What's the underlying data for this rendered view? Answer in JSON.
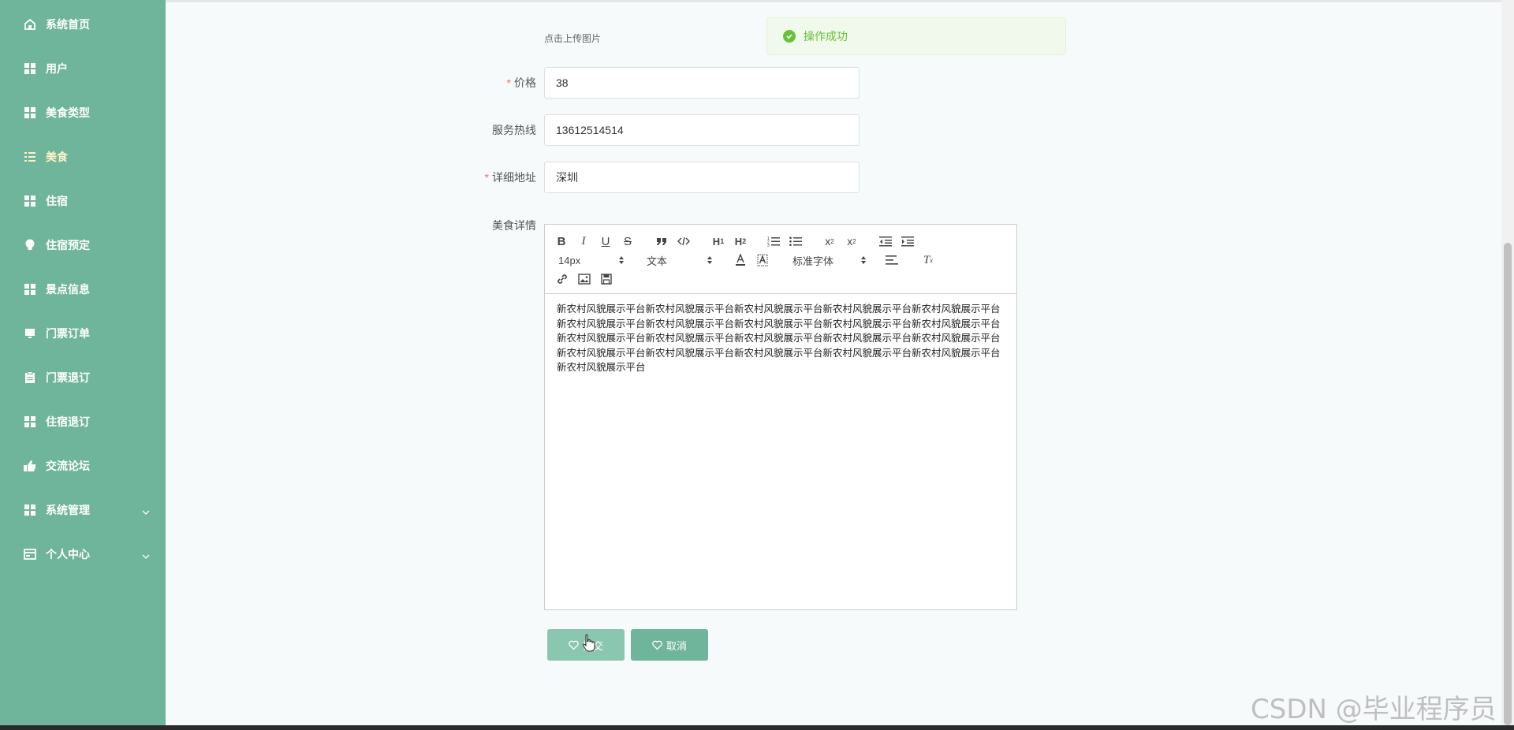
{
  "sidebar": {
    "items": [
      {
        "label": "系统首页",
        "icon": "home-icon"
      },
      {
        "label": "用户",
        "icon": "grid-icon"
      },
      {
        "label": "美食类型",
        "icon": "grid-icon"
      },
      {
        "label": "美食",
        "icon": "list-icon",
        "active": true
      },
      {
        "label": "住宿",
        "icon": "grid-icon"
      },
      {
        "label": "住宿预定",
        "icon": "bulb-icon"
      },
      {
        "label": "景点信息",
        "icon": "grid-icon"
      },
      {
        "label": "门票订单",
        "icon": "monitor-icon"
      },
      {
        "label": "门票退订",
        "icon": "clipboard-icon"
      },
      {
        "label": "住宿退订",
        "icon": "grid-icon"
      },
      {
        "label": "交流论坛",
        "icon": "thumb-icon"
      },
      {
        "label": "系统管理",
        "icon": "grid-icon",
        "expandable": true
      },
      {
        "label": "个人中心",
        "icon": "card-icon",
        "expandable": true
      }
    ]
  },
  "form": {
    "upload_hint": "点击上传图片",
    "price_label": "价格",
    "price_value": "38",
    "hotline_label": "服务热线",
    "hotline_value": "13612514514",
    "address_label": "详细地址",
    "address_value": "深圳",
    "detail_label": "美食详情"
  },
  "toast": {
    "message": "操作成功",
    "color": "#67c23a"
  },
  "editor": {
    "font_size": "14px",
    "text_type": "文本",
    "font_family": "标准字体",
    "content": "新农村风貌展示平台新农村风貌展示平台新农村风貌展示平台新农村风貌展示平台新农村风貌展示平台新农村风貌展示平台新农村风貌展示平台新农村风貌展示平台新农村风貌展示平台新农村风貌展示平台新农村风貌展示平台新农村风貌展示平台新农村风貌展示平台新农村风貌展示平台新农村风貌展示平台新农村风貌展示平台新农村风貌展示平台新农村风貌展示平台新农村风貌展示平台新农村风貌展示平台新农村风貌展示平台"
  },
  "buttons": {
    "submit_label": "提交",
    "cancel_label": "取消"
  },
  "watermark": "CSDN @毕业程序员",
  "colors": {
    "sidebar": "#6fb59b",
    "active_menu": "#fff3c4",
    "required": "#f56c6c"
  }
}
